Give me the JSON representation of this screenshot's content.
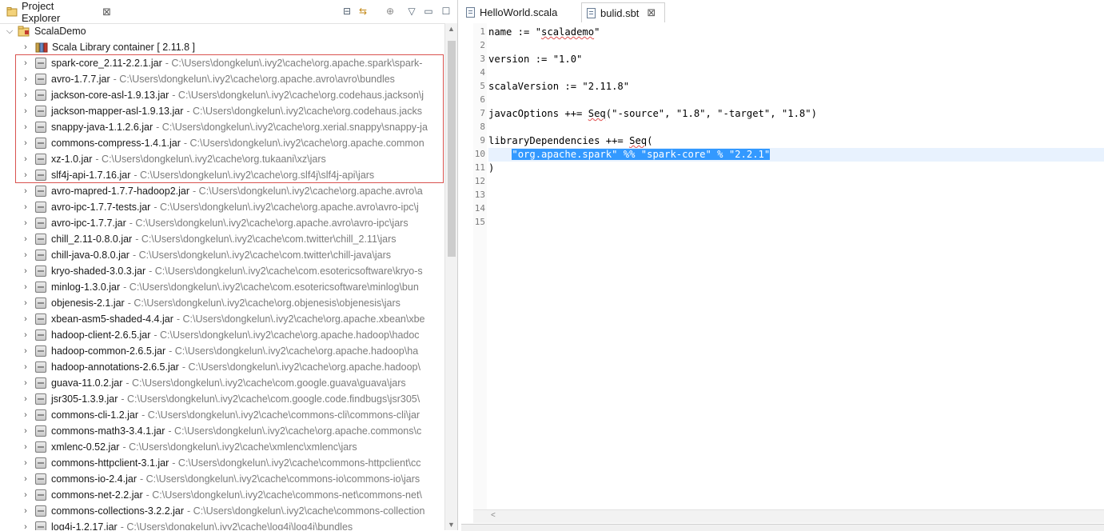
{
  "explorer": {
    "view_title": "Project Explorer",
    "close_label": "⊠",
    "toolbar": {
      "collapse_all": "⊟",
      "link_editor": "⇆",
      "focus": "⊕",
      "view_menu": "▽",
      "minimize": "▭",
      "maximize": "☐"
    },
    "project": {
      "name": "ScalaDemo",
      "expanded": true
    },
    "library": {
      "label": "Scala Library container [ 2.11.8 ]"
    },
    "jars": [
      {
        "name": "spark-core_2.11-2.2.1.jar",
        "path": "- C:\\Users\\dongkelun\\.ivy2\\cache\\org.apache.spark\\spark-"
      },
      {
        "name": "avro-1.7.7.jar",
        "path": "- C:\\Users\\dongkelun\\.ivy2\\cache\\org.apache.avro\\avro\\bundles"
      },
      {
        "name": "jackson-core-asl-1.9.13.jar",
        "path": "- C:\\Users\\dongkelun\\.ivy2\\cache\\org.codehaus.jackson\\j"
      },
      {
        "name": "jackson-mapper-asl-1.9.13.jar",
        "path": "- C:\\Users\\dongkelun\\.ivy2\\cache\\org.codehaus.jacks"
      },
      {
        "name": "snappy-java-1.1.2.6.jar",
        "path": "- C:\\Users\\dongkelun\\.ivy2\\cache\\org.xerial.snappy\\snappy-ja"
      },
      {
        "name": "commons-compress-1.4.1.jar",
        "path": "- C:\\Users\\dongkelun\\.ivy2\\cache\\org.apache.common"
      },
      {
        "name": "xz-1.0.jar",
        "path": "- C:\\Users\\dongkelun\\.ivy2\\cache\\org.tukaani\\xz\\jars"
      },
      {
        "name": "slf4j-api-1.7.16.jar",
        "path": "- C:\\Users\\dongkelun\\.ivy2\\cache\\org.slf4j\\slf4j-api\\jars"
      },
      {
        "name": "avro-mapred-1.7.7-hadoop2.jar",
        "path": "- C:\\Users\\dongkelun\\.ivy2\\cache\\org.apache.avro\\a"
      },
      {
        "name": "avro-ipc-1.7.7-tests.jar",
        "path": "- C:\\Users\\dongkelun\\.ivy2\\cache\\org.apache.avro\\avro-ipc\\j"
      },
      {
        "name": "avro-ipc-1.7.7.jar",
        "path": "- C:\\Users\\dongkelun\\.ivy2\\cache\\org.apache.avro\\avro-ipc\\jars"
      },
      {
        "name": "chill_2.11-0.8.0.jar",
        "path": "- C:\\Users\\dongkelun\\.ivy2\\cache\\com.twitter\\chill_2.11\\jars"
      },
      {
        "name": "chill-java-0.8.0.jar",
        "path": "- C:\\Users\\dongkelun\\.ivy2\\cache\\com.twitter\\chill-java\\jars"
      },
      {
        "name": "kryo-shaded-3.0.3.jar",
        "path": "- C:\\Users\\dongkelun\\.ivy2\\cache\\com.esotericsoftware\\kryo-s"
      },
      {
        "name": "minlog-1.3.0.jar",
        "path": "- C:\\Users\\dongkelun\\.ivy2\\cache\\com.esotericsoftware\\minlog\\bun"
      },
      {
        "name": "objenesis-2.1.jar",
        "path": "- C:\\Users\\dongkelun\\.ivy2\\cache\\org.objenesis\\objenesis\\jars"
      },
      {
        "name": "xbean-asm5-shaded-4.4.jar",
        "path": "- C:\\Users\\dongkelun\\.ivy2\\cache\\org.apache.xbean\\xbe"
      },
      {
        "name": "hadoop-client-2.6.5.jar",
        "path": "- C:\\Users\\dongkelun\\.ivy2\\cache\\org.apache.hadoop\\hadoc"
      },
      {
        "name": "hadoop-common-2.6.5.jar",
        "path": "- C:\\Users\\dongkelun\\.ivy2\\cache\\org.apache.hadoop\\ha"
      },
      {
        "name": "hadoop-annotations-2.6.5.jar",
        "path": "- C:\\Users\\dongkelun\\.ivy2\\cache\\org.apache.hadoop\\"
      },
      {
        "name": "guava-11.0.2.jar",
        "path": "- C:\\Users\\dongkelun\\.ivy2\\cache\\com.google.guava\\guava\\jars"
      },
      {
        "name": "jsr305-1.3.9.jar",
        "path": "- C:\\Users\\dongkelun\\.ivy2\\cache\\com.google.code.findbugs\\jsr305\\"
      },
      {
        "name": "commons-cli-1.2.jar",
        "path": "- C:\\Users\\dongkelun\\.ivy2\\cache\\commons-cli\\commons-cli\\jar"
      },
      {
        "name": "commons-math3-3.4.1.jar",
        "path": "- C:\\Users\\dongkelun\\.ivy2\\cache\\org.apache.commons\\c"
      },
      {
        "name": "xmlenc-0.52.jar",
        "path": "- C:\\Users\\dongkelun\\.ivy2\\cache\\xmlenc\\xmlenc\\jars"
      },
      {
        "name": "commons-httpclient-3.1.jar",
        "path": "- C:\\Users\\dongkelun\\.ivy2\\cache\\commons-httpclient\\cc"
      },
      {
        "name": "commons-io-2.4.jar",
        "path": "- C:\\Users\\dongkelun\\.ivy2\\cache\\commons-io\\commons-io\\jars"
      },
      {
        "name": "commons-net-2.2.jar",
        "path": "- C:\\Users\\dongkelun\\.ivy2\\cache\\commons-net\\commons-net\\"
      },
      {
        "name": "commons-collections-3.2.2.jar",
        "path": "- C:\\Users\\dongkelun\\.ivy2\\cache\\commons-collection"
      },
      {
        "name": "log4j-1.2.17.jar",
        "path": "- C:\\Users\\dongkelun\\.ivy2\\cache\\log4j\\log4j\\bundles"
      }
    ],
    "highlight_color": "#d9534f"
  },
  "editor": {
    "tabs": [
      {
        "label": "HelloWorld.scala",
        "active": false
      },
      {
        "label": "bulid.sbt",
        "active": true,
        "close": "⊠"
      }
    ],
    "lines": [
      {
        "num": "1",
        "text": "name := \"scalademo\""
      },
      {
        "num": "2",
        "text": ""
      },
      {
        "num": "3",
        "text": "version := \"1.0\""
      },
      {
        "num": "4",
        "text": ""
      },
      {
        "num": "5",
        "text": "scalaVersion := \"2.11.8\""
      },
      {
        "num": "6",
        "text": ""
      },
      {
        "num": "7",
        "text": "javacOptions ++= Seq(\"-source\", \"1.8\", \"-target\", \"1.8\")"
      },
      {
        "num": "8",
        "text": ""
      },
      {
        "num": "9",
        "text": "libraryDependencies ++= Seq("
      },
      {
        "num": "10",
        "text": "    \"org.apache.spark\" %% \"spark-core\" % \"2.2.1\""
      },
      {
        "num": "11",
        "text": ")"
      },
      {
        "num": "12",
        "text": ""
      },
      {
        "num": "13",
        "text": ""
      },
      {
        "num": "14",
        "text": ""
      },
      {
        "num": "15",
        "text": ""
      }
    ],
    "selected_line": "10",
    "selection_color": "#3399ff",
    "current_line_color": "#e8f2fe",
    "scroll_left_arrow": "<"
  }
}
